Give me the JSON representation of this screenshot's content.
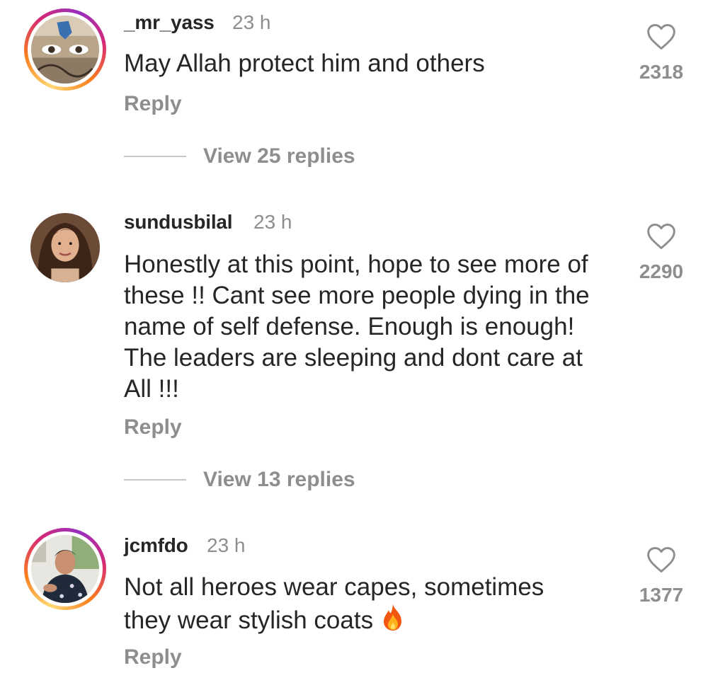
{
  "comments": [
    {
      "username": "_mr_yass",
      "time": "23 h",
      "text": "May Allah protect him and others",
      "reply_label": "Reply",
      "likes": "2318",
      "view_replies": "View 25 replies",
      "avatar_icon": "avatar-photo",
      "story_ring": true
    },
    {
      "username": "sundusbilal",
      "time": "23 h",
      "text": "Honestly at this point, hope to see more of these !! Cant see more people dying in the name of self defense. Enough is enough! The leaders are sleeping and dont care at All !!!",
      "reply_label": "Reply",
      "likes": "2290",
      "view_replies": "View 13 replies",
      "avatar_icon": "avatar-photo",
      "story_ring": false
    },
    {
      "username": "jcmfdo",
      "time": "23 h",
      "text": "Not all heroes wear capes, sometimes they wear stylish coats",
      "emoji": "fire-emoji",
      "reply_label": "Reply",
      "likes": "1377",
      "avatar_icon": "avatar-photo",
      "story_ring": true
    }
  ],
  "colors": {
    "primary_text": "#262626",
    "secondary_text": "#8e8e8e",
    "divider": "#c7c7c7"
  }
}
